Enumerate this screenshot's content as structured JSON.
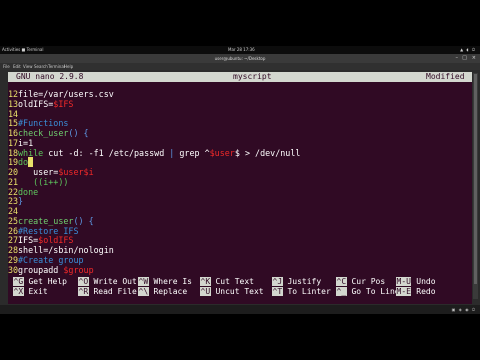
{
  "topbar": {
    "activities": "Activities  ■ Terminal",
    "clock": "Mar 28  17:36",
    "system_icons": "▲ ◖ ⏻"
  },
  "window": {
    "title": "user@ubuntu: ~/Desktop",
    "menu": [
      "File",
      "Edit",
      "View",
      "Search",
      "Terminal",
      "Help"
    ]
  },
  "nano": {
    "version": "GNU nano 2.9.8",
    "filename": "myscript",
    "status": "Modified",
    "lines": [
      {
        "n": "12",
        "segments": [
          {
            "t": "file=/var/users.csv",
            "c": "code"
          }
        ]
      },
      {
        "n": "13",
        "segments": [
          {
            "t": "oldIFS=",
            "c": "code"
          },
          {
            "t": "$IFS",
            "c": "c-var"
          }
        ]
      },
      {
        "n": "14",
        "segments": []
      },
      {
        "n": "15",
        "segments": [
          {
            "t": "#Functions",
            "c": "c-cmt"
          }
        ]
      },
      {
        "n": "16",
        "segments": [
          {
            "t": "check_user",
            "c": "c-fn"
          },
          {
            "t": "() {",
            "c": "c-def"
          }
        ]
      },
      {
        "n": "17",
        "segments": [
          {
            "t": "i=1",
            "c": "code"
          }
        ]
      },
      {
        "n": "18",
        "segments": [
          {
            "t": "while ",
            "c": "c-kw"
          },
          {
            "t": "cut -d: -f1 /etc/passwd ",
            "c": "code"
          },
          {
            "t": "| ",
            "c": "c-def"
          },
          {
            "t": "grep ^",
            "c": "code"
          },
          {
            "t": "$user",
            "c": "c-var"
          },
          {
            "t": "$ > /dev/null",
            "c": "code"
          }
        ]
      },
      {
        "n": "19",
        "segments": [
          {
            "t": "do",
            "c": "c-kw"
          },
          {
            "t": " ",
            "c": "cursor"
          }
        ]
      },
      {
        "n": "20",
        "segments": [
          {
            "t": "   user=",
            "c": "code"
          },
          {
            "t": "$user$i",
            "c": "c-var"
          }
        ]
      },
      {
        "n": "21",
        "segments": [
          {
            "t": "   ((i++))",
            "c": "c-kw"
          }
        ]
      },
      {
        "n": "22",
        "segments": [
          {
            "t": "done",
            "c": "c-kw"
          }
        ]
      },
      {
        "n": "23",
        "segments": [
          {
            "t": "}",
            "c": "c-def"
          }
        ]
      },
      {
        "n": "24",
        "segments": []
      },
      {
        "n": "25",
        "segments": [
          {
            "t": "create_user",
            "c": "c-fn"
          },
          {
            "t": "() {",
            "c": "c-def"
          }
        ]
      },
      {
        "n": "26",
        "segments": [
          {
            "t": "#Restore IFS",
            "c": "c-cmt"
          }
        ]
      },
      {
        "n": "27",
        "segments": [
          {
            "t": "IFS=",
            "c": "code"
          },
          {
            "t": "$oldIFS",
            "c": "c-var"
          }
        ]
      },
      {
        "n": "28",
        "segments": [
          {
            "t": "shell=/sbin/nologin",
            "c": "code"
          }
        ]
      },
      {
        "n": "29",
        "segments": [
          {
            "t": "#Create group",
            "c": "c-cmt"
          }
        ]
      },
      {
        "n": "30",
        "segments": [
          {
            "t": "groupadd ",
            "c": "code"
          },
          {
            "t": "$group",
            "c": "c-var"
          }
        ]
      }
    ],
    "shortcuts": [
      {
        "key": "^G",
        "label": "Get Help"
      },
      {
        "key": "^O",
        "label": "Write Out"
      },
      {
        "key": "^W",
        "label": "Where Is"
      },
      {
        "key": "^K",
        "label": "Cut Text"
      },
      {
        "key": "^J",
        "label": "Justify"
      },
      {
        "key": "^C",
        "label": "Cur Pos"
      },
      {
        "key": "M-U",
        "label": "Undo"
      },
      {
        "key": "^X",
        "label": "Exit"
      },
      {
        "key": "^R",
        "label": "Read File"
      },
      {
        "key": "^\\",
        "label": "Replace"
      },
      {
        "key": "^U",
        "label": "Uncut Text"
      },
      {
        "key": "^T",
        "label": "To Linter"
      },
      {
        "key": "^_",
        "label": "Go To Line"
      },
      {
        "key": "M-E",
        "label": "Redo"
      }
    ]
  },
  "taskbar": {
    "tray": "▣ ◈ ◉ ⏻"
  }
}
